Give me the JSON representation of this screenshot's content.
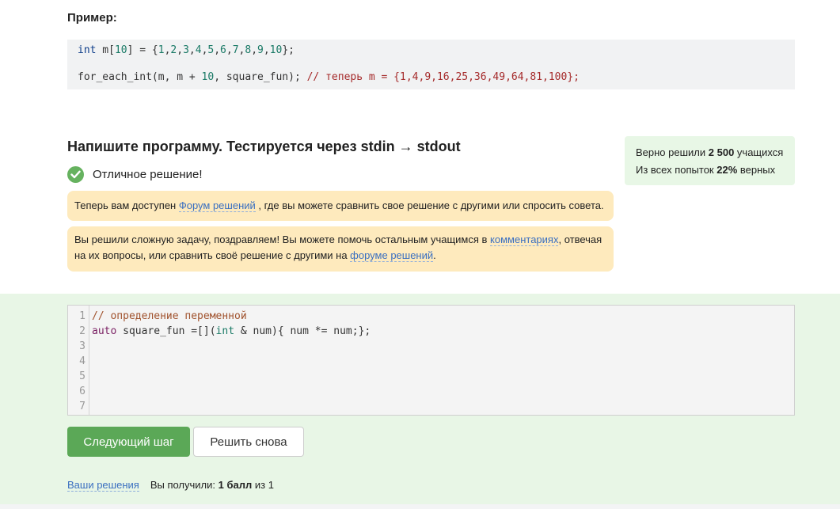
{
  "example": {
    "label": "Пример:",
    "line1": [
      {
        "t": "int",
        "c": "kw"
      },
      {
        "t": " m[",
        "c": ""
      },
      {
        "t": "10",
        "c": "num"
      },
      {
        "t": "] = {",
        "c": ""
      },
      {
        "t": "1",
        "c": "num"
      },
      {
        "t": ",",
        "c": ""
      },
      {
        "t": "2",
        "c": "num"
      },
      {
        "t": ",",
        "c": ""
      },
      {
        "t": "3",
        "c": "num"
      },
      {
        "t": ",",
        "c": ""
      },
      {
        "t": "4",
        "c": "num"
      },
      {
        "t": ",",
        "c": ""
      },
      {
        "t": "5",
        "c": "num"
      },
      {
        "t": ",",
        "c": ""
      },
      {
        "t": "6",
        "c": "num"
      },
      {
        "t": ",",
        "c": ""
      },
      {
        "t": "7",
        "c": "num"
      },
      {
        "t": ",",
        "c": ""
      },
      {
        "t": "8",
        "c": "num"
      },
      {
        "t": ",",
        "c": ""
      },
      {
        "t": "9",
        "c": "num"
      },
      {
        "t": ",",
        "c": ""
      },
      {
        "t": "10",
        "c": "num"
      },
      {
        "t": "};",
        "c": ""
      }
    ],
    "line2": [
      {
        "t": "for_each_int(m, m + ",
        "c": ""
      },
      {
        "t": "10",
        "c": "num"
      },
      {
        "t": ", square_fun); ",
        "c": ""
      },
      {
        "t": "// теперь m = {1,4,9,16,25,36,49,64,81,100};",
        "c": "cmt"
      }
    ]
  },
  "task": {
    "title": "Напишите программу. Тестируется через stdin → stdout",
    "success_text": "Отличное решение!"
  },
  "notice1": {
    "before": "Теперь вам доступен ",
    "link": "Форум решений",
    "after": " , где вы можете сравнить свое решение с другими или спросить совета."
  },
  "notice2": {
    "before": "Вы решили сложную задачу, поздравляем! Вы можете помочь остальным учащимся в ",
    "link1": "комментариях",
    "middle": ", отвечая на их вопросы, или сравнить своё решение с другими на ",
    "link2": "форуме решений",
    "after": "."
  },
  "stats": {
    "solved_prefix": "Верно решили ",
    "solved_count": "2 500",
    "solved_suffix": " учащихся",
    "attempts_prefix": "Из всех попыток ",
    "attempts_percent": "22%",
    "attempts_suffix": " верных"
  },
  "editor": {
    "line_numbers": [
      "1",
      "2",
      "3",
      "4",
      "5",
      "6",
      "7"
    ],
    "lines": [
      [
        {
          "t": "// определение переменной",
          "c": "ccmt"
        }
      ],
      [
        {
          "t": "auto",
          "c": "ckw"
        },
        {
          "t": " square_fun =[](",
          "c": ""
        },
        {
          "t": "int",
          "c": "ctype"
        },
        {
          "t": " & num){ num *= num;};",
          "c": ""
        }
      ],
      [],
      [],
      [],
      [],
      []
    ]
  },
  "buttons": {
    "next": "Следующий шаг",
    "retry": "Решить снова"
  },
  "footer": {
    "link": "Ваши решения",
    "score_prefix": "Вы получили: ",
    "score_bold": "1 балл",
    "score_suffix": " из 1"
  },
  "colors": {
    "accent_green": "#5ba857",
    "notice_bg": "#feeabd",
    "zone_bg": "#e8f6e6",
    "link": "#3a6fc0"
  }
}
